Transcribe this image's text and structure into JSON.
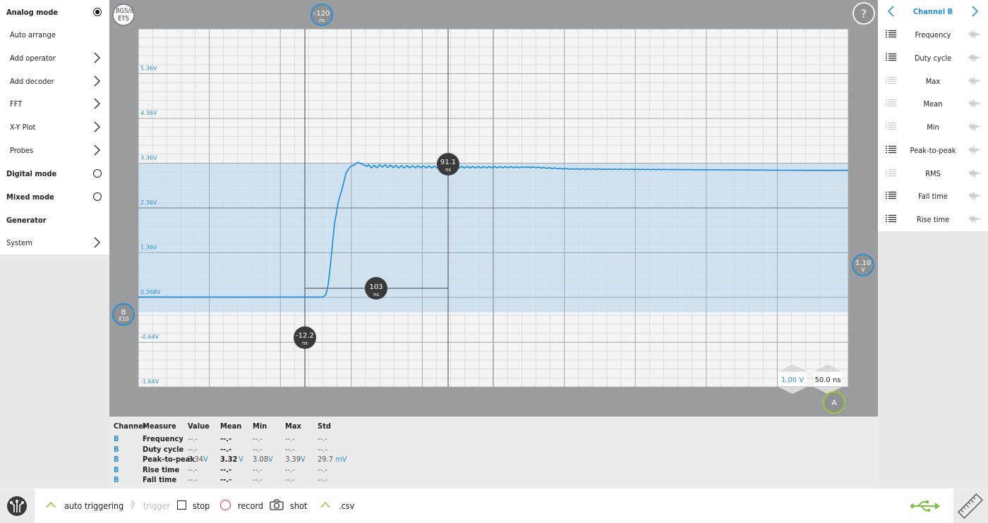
{
  "left_menu": {
    "analog_mode": "Analog mode",
    "auto_arrange": "Auto arrange",
    "add_operator": "Add operator",
    "add_decoder": "Add decoder",
    "fft": "FFT",
    "xy_plot": "X-Y Plot",
    "probes": "Probes",
    "digital_mode": "Digital mode",
    "mixed_mode": "Mixed mode",
    "generator": "Generator",
    "system": "System"
  },
  "scope": {
    "sample_rate_line1": ".8GS/s",
    "sample_rate_line2": "ETS",
    "trigger_offset_value": "-120",
    "trigger_offset_unit": "ns",
    "help_label": "?",
    "channel_marker_label": "B",
    "channel_marker_probe": "X10",
    "trigger_level_value": "1.10",
    "trigger_level_unit": "V",
    "cursor_left_value": "-12.2",
    "cursor_left_unit": "ns",
    "cursor_right_value": "91.1",
    "cursor_right_unit": "ns",
    "cursor_delta_value": "103",
    "cursor_delta_unit": "ns",
    "volts_per_div": "1.00 V",
    "time_per_div": "50.0 ns",
    "trigger_source": "A",
    "y_tick_labels": [
      "5.36V",
      "4.36V",
      "3.36V",
      "2.36V",
      "1.36V",
      "0.368V",
      "-0.64V",
      "-1.64V"
    ],
    "colors": {
      "trace": "#1a8ad8",
      "accent": "#2a8fd4",
      "band": "#cfe2f1",
      "trigger_green": "#9bc83a"
    }
  },
  "chart_data": {
    "type": "line",
    "series": [
      {
        "name": "B",
        "x": [
          -250,
          -150,
          -118,
          -15,
          -12,
          -10,
          -8,
          -5,
          0,
          5,
          10,
          15,
          20,
          25,
          30,
          40,
          50,
          60,
          80,
          100,
          150,
          200,
          250,
          300,
          400,
          500,
          600,
          655
        ],
        "y": [
          0.37,
          0.37,
          0.37,
          0.37,
          0.4,
          0.48,
          0.65,
          1.1,
          2.0,
          2.5,
          2.8,
          3.15,
          3.28,
          3.32,
          3.38,
          3.3,
          3.28,
          3.3,
          3.28,
          3.28,
          3.27,
          3.27,
          3.27,
          3.23,
          3.22,
          3.21,
          3.2,
          3.2
        ]
      }
    ],
    "xlabel": "",
    "ylabel": "",
    "xlim": [
      -250,
      655
    ],
    "ylim": [
      -1.64,
      6.36
    ],
    "y_tick_labels": [
      "5.36V",
      "4.36V",
      "3.36V",
      "2.36V",
      "1.36V",
      "0.368V",
      "-0.64V",
      "-1.64V"
    ],
    "grid": true
  },
  "right_panel": {
    "title": "Channel B",
    "items": [
      {
        "label": "Frequency",
        "active": true
      },
      {
        "label": "Duty cycle",
        "active": true
      },
      {
        "label": "Max",
        "active": false
      },
      {
        "label": "Mean",
        "active": false
      },
      {
        "label": "Min",
        "active": false
      },
      {
        "label": "Peak-to-peak",
        "active": true
      },
      {
        "label": "RMS",
        "active": false
      },
      {
        "label": "Fall time",
        "active": true
      },
      {
        "label": "Rise time",
        "active": true
      }
    ]
  },
  "measurements": {
    "headers": [
      "Channel",
      "Measure",
      "Value",
      "Mean",
      "Min",
      "Max",
      "Std"
    ],
    "rows": [
      {
        "channel": "B",
        "measure": "Frequency",
        "value": "--.-",
        "value_unit": "",
        "mean": "--.-",
        "mean_unit": "",
        "min": "--.-",
        "min_unit": "",
        "max": "--.-",
        "max_unit": "",
        "std": "--.-",
        "std_unit": ""
      },
      {
        "channel": "B",
        "measure": "Duty cycle",
        "value": "--.-",
        "value_unit": "",
        "mean": "--.-",
        "mean_unit": "",
        "min": "--.-",
        "min_unit": "",
        "max": "--.-",
        "max_unit": "",
        "std": "--.-",
        "std_unit": ""
      },
      {
        "channel": "B",
        "measure": "Peak-to-peak",
        "value": "3.34",
        "value_unit": "V",
        "mean": "3.32",
        "mean_unit": "V",
        "min": "3.08",
        "min_unit": "V",
        "max": "3.39",
        "max_unit": "V",
        "std": "29.7",
        "std_unit": "mV"
      },
      {
        "channel": "B",
        "measure": "Rise time",
        "value": "--.-",
        "value_unit": "",
        "mean": "--.-",
        "mean_unit": "",
        "min": "--.-",
        "min_unit": "",
        "max": "--.-",
        "max_unit": "",
        "std": "--.-",
        "std_unit": ""
      },
      {
        "channel": "B",
        "measure": "Fall time",
        "value": "--.-",
        "value_unit": "",
        "mean": "--.-",
        "mean_unit": "",
        "min": "--.-",
        "min_unit": "",
        "max": "--.-",
        "max_unit": "",
        "std": "--.-",
        "std_unit": ""
      }
    ]
  },
  "toolbar": {
    "auto_triggering": "auto triggering",
    "trigger": "trigger",
    "stop": "stop",
    "record": "record",
    "shot": "shot",
    "csv": ".csv"
  }
}
